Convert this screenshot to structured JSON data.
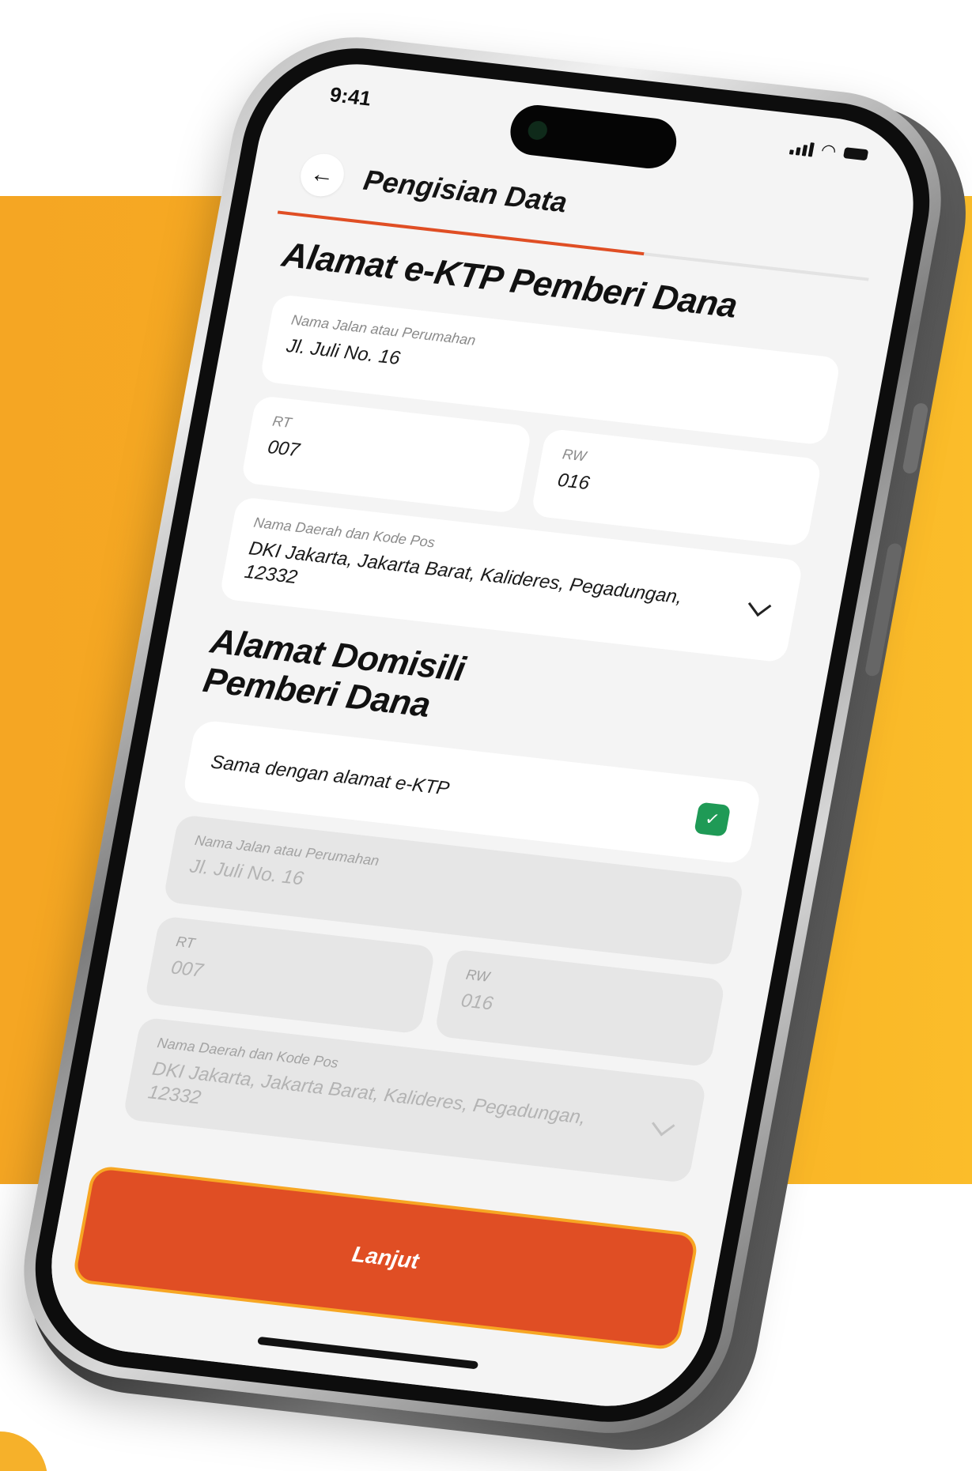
{
  "status_bar": {
    "time": "9:41"
  },
  "header": {
    "title": "Pengisian Data",
    "progress_fraction": 0.62
  },
  "ktp_section": {
    "title": "Alamat e-KTP Pemberi Dana",
    "street": {
      "label": "Nama Jalan atau Perumahan",
      "value": "Jl. Juli No. 16"
    },
    "rt": {
      "label": "RT",
      "value": "007"
    },
    "rw": {
      "label": "RW",
      "value": "016"
    },
    "region": {
      "label": "Nama Daerah dan Kode Pos",
      "value": "DKI Jakarta, Jakarta Barat, Kalideres, Pegadungan,  12332"
    }
  },
  "domicile_section": {
    "title": "Alamat Domisili Pemberi Dana",
    "same_as_ktp": {
      "label": "Sama dengan alamat e-KTP",
      "checked": true
    },
    "street": {
      "label": "Nama Jalan atau Perumahan",
      "value": "Jl. Juli No. 16"
    },
    "rt": {
      "label": "RT",
      "value": "007"
    },
    "rw": {
      "label": "RW",
      "value": "016"
    },
    "region": {
      "label": "Nama Daerah dan Kode Pos",
      "value": "DKI Jakarta, Jakarta Barat, Kalideres, Pegadungan,  12332"
    }
  },
  "footer": {
    "continue_label": "Lanjut"
  },
  "colors": {
    "accent": "#e04e24",
    "check": "#1f9a56",
    "backdrop": "#f5a623",
    "cta_border": "#f7a623"
  },
  "icons": {
    "back": "arrow-left-icon",
    "chevron": "chevron-down-icon",
    "check": "check-icon"
  }
}
